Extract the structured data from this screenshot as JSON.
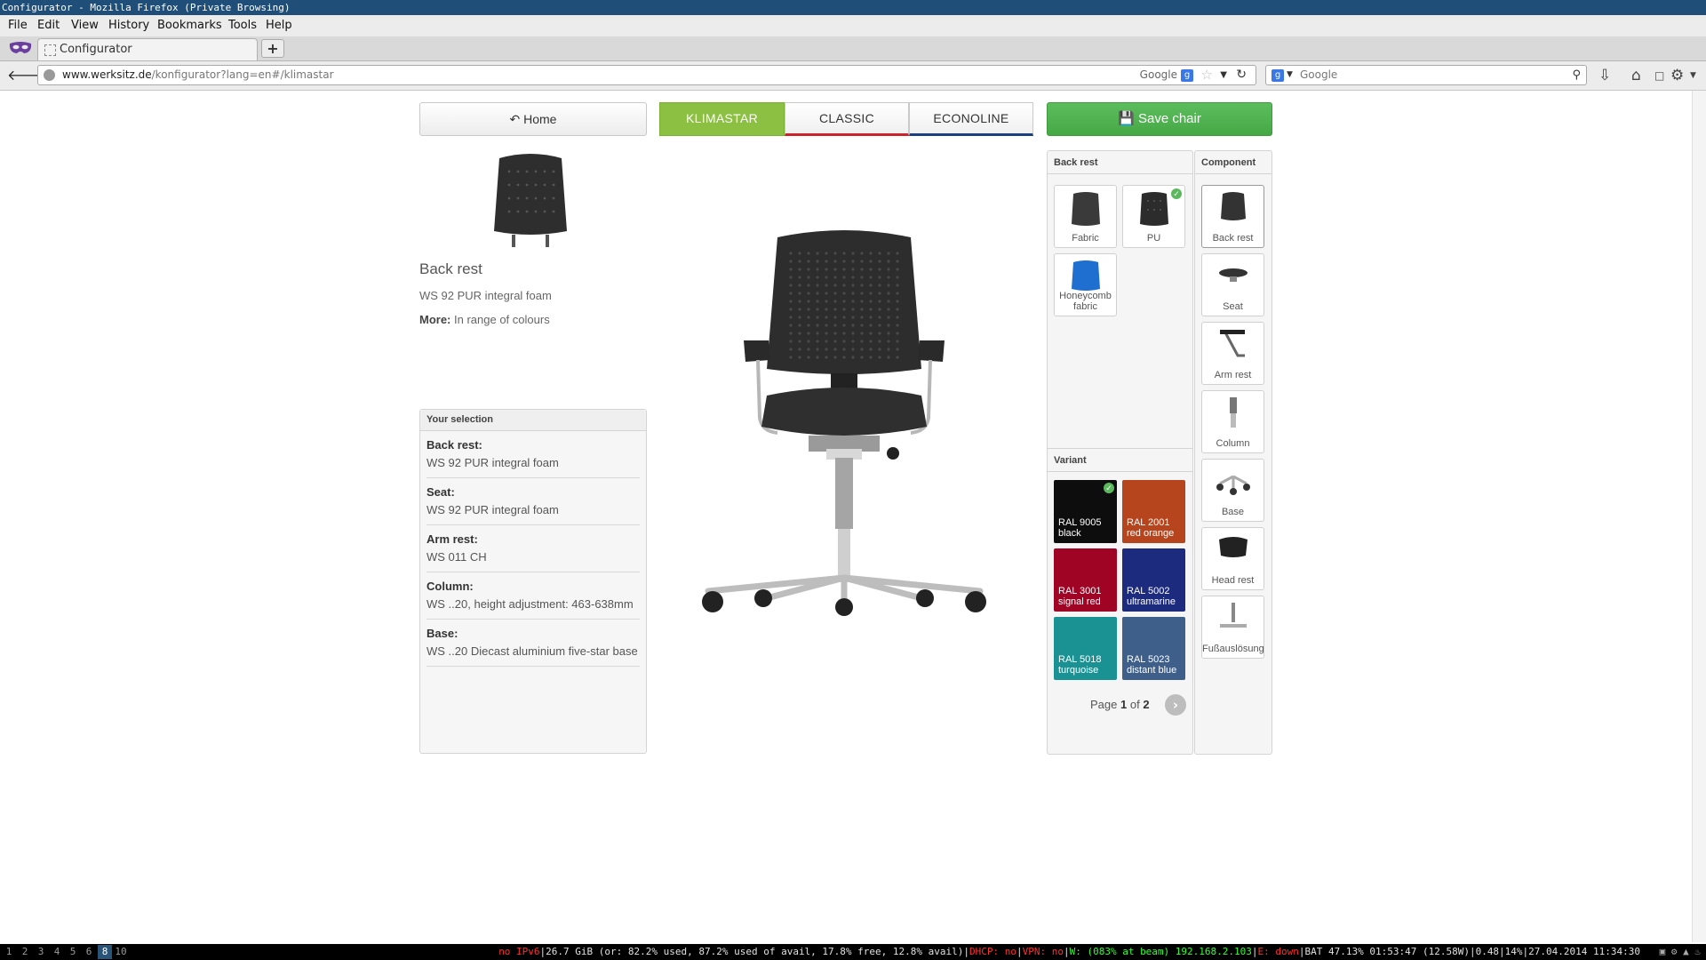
{
  "window": {
    "title": "Configurator - Mozilla Firefox (Private Browsing)"
  },
  "menu": [
    "File",
    "Edit",
    "View",
    "History",
    "Bookmarks",
    "Tools",
    "Help"
  ],
  "tab": {
    "title": "Configurator",
    "new_tab": "+"
  },
  "navbar": {
    "url_domain": "www.werksitz.de",
    "url_path": "/konfigurator?lang=en#/klimastar",
    "search_engine": "Google",
    "search_placeholder": "Google"
  },
  "page": {
    "home_label": "Home",
    "tabs": [
      "KLIMASTAR",
      "CLASSIC",
      "ECONOLINE"
    ],
    "save_label": "Save chair",
    "component": {
      "title": "Back rest",
      "description": "WS 92 PUR integral foam",
      "more_label": "More:",
      "more_value": "In range of colours"
    },
    "selection": {
      "title": "Your selection",
      "rows": [
        {
          "label": "Back rest:",
          "value": "WS 92 PUR integral foam"
        },
        {
          "label": "Seat:",
          "value": "WS 92 PUR integral foam"
        },
        {
          "label": "Arm rest:",
          "value": "WS 011 CH"
        },
        {
          "label": "Column:",
          "value": "WS ..20, height adjustment: 463-638mm"
        },
        {
          "label": "Base:",
          "value": "WS ..20 Diecast aluminium five-star base"
        }
      ]
    },
    "backrest_panel": {
      "title": "Back rest",
      "options": [
        {
          "label": "Fabric",
          "selected": false
        },
        {
          "label": "PU",
          "selected": true
        },
        {
          "label": "Honeycomb fabric",
          "selected": false
        }
      ]
    },
    "variant_panel": {
      "title": "Variant",
      "swatches": [
        {
          "code": "RAL 9005",
          "name": "black",
          "color": "#0d0d0d",
          "selected": true
        },
        {
          "code": "RAL 2001",
          "name": "red orange",
          "color": "#b6451e",
          "selected": false
        },
        {
          "code": "RAL 3001",
          "name": "signal red",
          "color": "#a00425",
          "selected": false
        },
        {
          "code": "RAL 5002",
          "name": "ultramarine",
          "color": "#1c2b7d",
          "selected": false
        },
        {
          "code": "RAL 5018",
          "name": "turquoise",
          "color": "#1a9294",
          "selected": false
        },
        {
          "code": "RAL 5023",
          "name": "distant blue",
          "color": "#3e5f8a",
          "selected": false
        }
      ],
      "page_prefix": "Page",
      "page_current": "1",
      "page_of": "of",
      "page_total": "2"
    },
    "component_panel": {
      "title": "Component",
      "items": [
        "Back rest",
        "Seat",
        "Arm rest",
        "Column",
        "Base",
        "Head rest",
        "Fußauslösung"
      ]
    }
  },
  "statusbar": {
    "workspaces": [
      "1",
      "2",
      "3",
      "4",
      "5",
      "6",
      "8",
      "10"
    ],
    "active_workspace": "8",
    "segments": [
      {
        "text": "no IPv6",
        "color": "#ff3030"
      },
      {
        "text": "|26.7 GiB (or: 82.2% used, 87.2% used of avail, 17.8% free, 12.8% avail)|",
        "color": "#e0e0e0"
      },
      {
        "text": "DHCP: no",
        "color": "#ff3030"
      },
      {
        "text": "|",
        "color": "#e0e0e0"
      },
      {
        "text": "VPN: no",
        "color": "#ff3030"
      },
      {
        "text": "|",
        "color": "#e0e0e0"
      },
      {
        "text": "W: (083% at beam) 192.168.2.103",
        "color": "#30ff30"
      },
      {
        "text": "|",
        "color": "#e0e0e0"
      },
      {
        "text": "E: down",
        "color": "#ff3030"
      },
      {
        "text": "|BAT 47.13% 01:53:47 (12.58W)|0.48|14%|27.04.2014 11:34:30",
        "color": "#e0e0e0"
      }
    ]
  }
}
